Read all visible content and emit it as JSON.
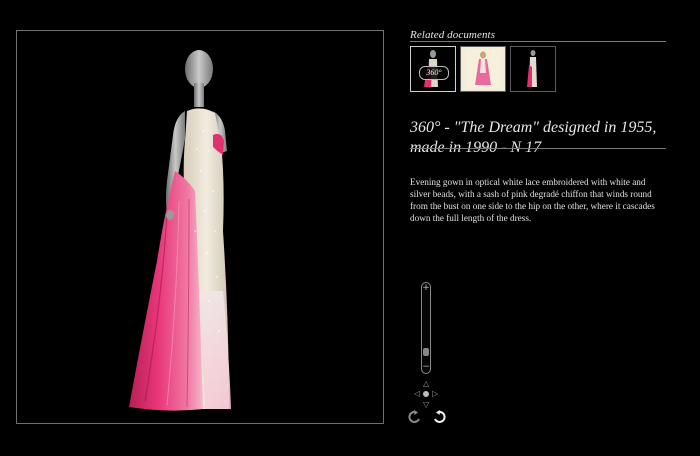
{
  "related": {
    "title": "Related documents",
    "thumbnails": [
      {
        "name": "360-view",
        "badge": "360°",
        "active": true
      },
      {
        "name": "sketch",
        "active": false
      },
      {
        "name": "dress-photo",
        "active": false
      }
    ]
  },
  "item": {
    "title": "360° - \"The Dream\" designed in 1955, made in 1990 - N 17",
    "description": "Evening gown in optical white lace embroidered with white and silver beads, with a sash of pink degradé chiffon that winds round from the bust on one side to the hip on the other, where it cascades down the full length of the dress."
  },
  "controls": {
    "zoom_in": "+",
    "zoom_out": "−",
    "zoom_level": 0.12,
    "pan_up": "△",
    "pan_down": "▽",
    "pan_left": "◁",
    "pan_right": "▷",
    "rotate_left_icon": "rotate-left-icon",
    "rotate_right_icon": "rotate-right-icon"
  },
  "colors": {
    "background": "#000000",
    "pink": "#e0306f",
    "lace": "#e9e2d2"
  }
}
